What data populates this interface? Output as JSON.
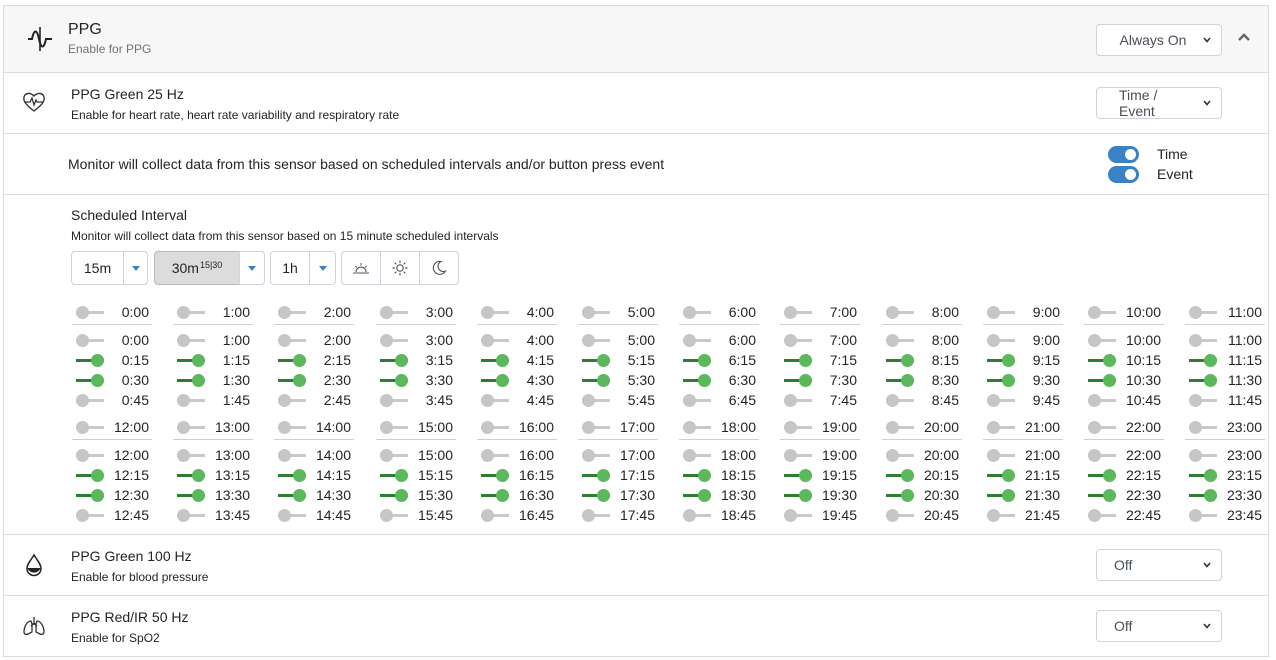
{
  "header": {
    "title": "PPG",
    "subtitle": "Enable for PPG",
    "mode": "Always On",
    "icon": "waveform-icon"
  },
  "sensors": [
    {
      "title": "PPG Green 25 Hz",
      "subtitle": "Enable for heart rate, heart rate variability and respiratory rate",
      "mode": "Time / Event",
      "icon": "heart-rate-icon"
    },
    {
      "title": "PPG Green 100 Hz",
      "subtitle": "Enable for blood pressure",
      "mode": "Off",
      "icon": "blood-drop-icon"
    },
    {
      "title": "PPG Red/IR 50 Hz",
      "subtitle": "Enable for SpO2",
      "mode": "Off",
      "icon": "lungs-icon"
    }
  ],
  "monitor": {
    "text": "Monitor will collect data from this sensor based on scheduled intervals and/or button press event",
    "time_label": "Time",
    "event_label": "Event",
    "time_on": true,
    "event_on": true
  },
  "schedule": {
    "title": "Scheduled Interval",
    "subtitle": "Monitor will collect data from this sensor based on 15 minute scheduled intervals",
    "interval_15": "15m",
    "interval_30": "30m",
    "interval_30_sup": "15|30",
    "interval_1h": "1h",
    "active_interval": "30m",
    "preset_icons": [
      "sunrise-icon",
      "sun-icon",
      "moon-icon"
    ],
    "hours": [
      {
        "hour": "0:00",
        "slots": [
          {
            "t": "0:00",
            "on": false
          },
          {
            "t": "0:15",
            "on": true
          },
          {
            "t": "0:30",
            "on": true
          },
          {
            "t": "0:45",
            "on": false
          }
        ]
      },
      {
        "hour": "1:00",
        "slots": [
          {
            "t": "1:00",
            "on": false
          },
          {
            "t": "1:15",
            "on": true
          },
          {
            "t": "1:30",
            "on": true
          },
          {
            "t": "1:45",
            "on": false
          }
        ]
      },
      {
        "hour": "2:00",
        "slots": [
          {
            "t": "2:00",
            "on": false
          },
          {
            "t": "2:15",
            "on": true
          },
          {
            "t": "2:30",
            "on": true
          },
          {
            "t": "2:45",
            "on": false
          }
        ]
      },
      {
        "hour": "3:00",
        "slots": [
          {
            "t": "3:00",
            "on": false
          },
          {
            "t": "3:15",
            "on": true
          },
          {
            "t": "3:30",
            "on": true
          },
          {
            "t": "3:45",
            "on": false
          }
        ]
      },
      {
        "hour": "4:00",
        "slots": [
          {
            "t": "4:00",
            "on": false
          },
          {
            "t": "4:15",
            "on": true
          },
          {
            "t": "4:30",
            "on": true
          },
          {
            "t": "4:45",
            "on": false
          }
        ]
      },
      {
        "hour": "5:00",
        "slots": [
          {
            "t": "5:00",
            "on": false
          },
          {
            "t": "5:15",
            "on": true
          },
          {
            "t": "5:30",
            "on": true
          },
          {
            "t": "5:45",
            "on": false
          }
        ]
      },
      {
        "hour": "6:00",
        "slots": [
          {
            "t": "6:00",
            "on": false
          },
          {
            "t": "6:15",
            "on": true
          },
          {
            "t": "6:30",
            "on": true
          },
          {
            "t": "6:45",
            "on": false
          }
        ]
      },
      {
        "hour": "7:00",
        "slots": [
          {
            "t": "7:00",
            "on": false
          },
          {
            "t": "7:15",
            "on": true
          },
          {
            "t": "7:30",
            "on": true
          },
          {
            "t": "7:45",
            "on": false
          }
        ]
      },
      {
        "hour": "8:00",
        "slots": [
          {
            "t": "8:00",
            "on": false
          },
          {
            "t": "8:15",
            "on": true
          },
          {
            "t": "8:30",
            "on": true
          },
          {
            "t": "8:45",
            "on": false
          }
        ]
      },
      {
        "hour": "9:00",
        "slots": [
          {
            "t": "9:00",
            "on": false
          },
          {
            "t": "9:15",
            "on": true
          },
          {
            "t": "9:30",
            "on": true
          },
          {
            "t": "9:45",
            "on": false
          }
        ]
      },
      {
        "hour": "10:00",
        "slots": [
          {
            "t": "10:00",
            "on": false
          },
          {
            "t": "10:15",
            "on": true
          },
          {
            "t": "10:30",
            "on": true
          },
          {
            "t": "10:45",
            "on": false
          }
        ]
      },
      {
        "hour": "11:00",
        "slots": [
          {
            "t": "11:00",
            "on": false
          },
          {
            "t": "11:15",
            "on": true
          },
          {
            "t": "11:30",
            "on": true
          },
          {
            "t": "11:45",
            "on": false
          }
        ]
      },
      {
        "hour": "12:00",
        "slots": [
          {
            "t": "12:00",
            "on": false
          },
          {
            "t": "12:15",
            "on": true
          },
          {
            "t": "12:30",
            "on": true
          },
          {
            "t": "12:45",
            "on": false
          }
        ]
      },
      {
        "hour": "13:00",
        "slots": [
          {
            "t": "13:00",
            "on": false
          },
          {
            "t": "13:15",
            "on": true
          },
          {
            "t": "13:30",
            "on": true
          },
          {
            "t": "13:45",
            "on": false
          }
        ]
      },
      {
        "hour": "14:00",
        "slots": [
          {
            "t": "14:00",
            "on": false
          },
          {
            "t": "14:15",
            "on": true
          },
          {
            "t": "14:30",
            "on": true
          },
          {
            "t": "14:45",
            "on": false
          }
        ]
      },
      {
        "hour": "15:00",
        "slots": [
          {
            "t": "15:00",
            "on": false
          },
          {
            "t": "15:15",
            "on": true
          },
          {
            "t": "15:30",
            "on": true
          },
          {
            "t": "15:45",
            "on": false
          }
        ]
      },
      {
        "hour": "16:00",
        "slots": [
          {
            "t": "16:00",
            "on": false
          },
          {
            "t": "16:15",
            "on": true
          },
          {
            "t": "16:30",
            "on": true
          },
          {
            "t": "16:45",
            "on": false
          }
        ]
      },
      {
        "hour": "17:00",
        "slots": [
          {
            "t": "17:00",
            "on": false
          },
          {
            "t": "17:15",
            "on": true
          },
          {
            "t": "17:30",
            "on": true
          },
          {
            "t": "17:45",
            "on": false
          }
        ]
      },
      {
        "hour": "18:00",
        "slots": [
          {
            "t": "18:00",
            "on": false
          },
          {
            "t": "18:15",
            "on": true
          },
          {
            "t": "18:30",
            "on": true
          },
          {
            "t": "18:45",
            "on": false
          }
        ]
      },
      {
        "hour": "19:00",
        "slots": [
          {
            "t": "19:00",
            "on": false
          },
          {
            "t": "19:15",
            "on": true
          },
          {
            "t": "19:30",
            "on": true
          },
          {
            "t": "19:45",
            "on": false
          }
        ]
      },
      {
        "hour": "20:00",
        "slots": [
          {
            "t": "20:00",
            "on": false
          },
          {
            "t": "20:15",
            "on": true
          },
          {
            "t": "20:30",
            "on": true
          },
          {
            "t": "20:45",
            "on": false
          }
        ]
      },
      {
        "hour": "21:00",
        "slots": [
          {
            "t": "21:00",
            "on": false
          },
          {
            "t": "21:15",
            "on": true
          },
          {
            "t": "21:30",
            "on": true
          },
          {
            "t": "21:45",
            "on": false
          }
        ]
      },
      {
        "hour": "22:00",
        "slots": [
          {
            "t": "22:00",
            "on": false
          },
          {
            "t": "22:15",
            "on": true
          },
          {
            "t": "22:30",
            "on": true
          },
          {
            "t": "22:45",
            "on": false
          }
        ]
      },
      {
        "hour": "23:00",
        "slots": [
          {
            "t": "23:00",
            "on": false
          },
          {
            "t": "23:15",
            "on": true
          },
          {
            "t": "23:30",
            "on": true
          },
          {
            "t": "23:45",
            "on": false
          }
        ]
      }
    ]
  }
}
